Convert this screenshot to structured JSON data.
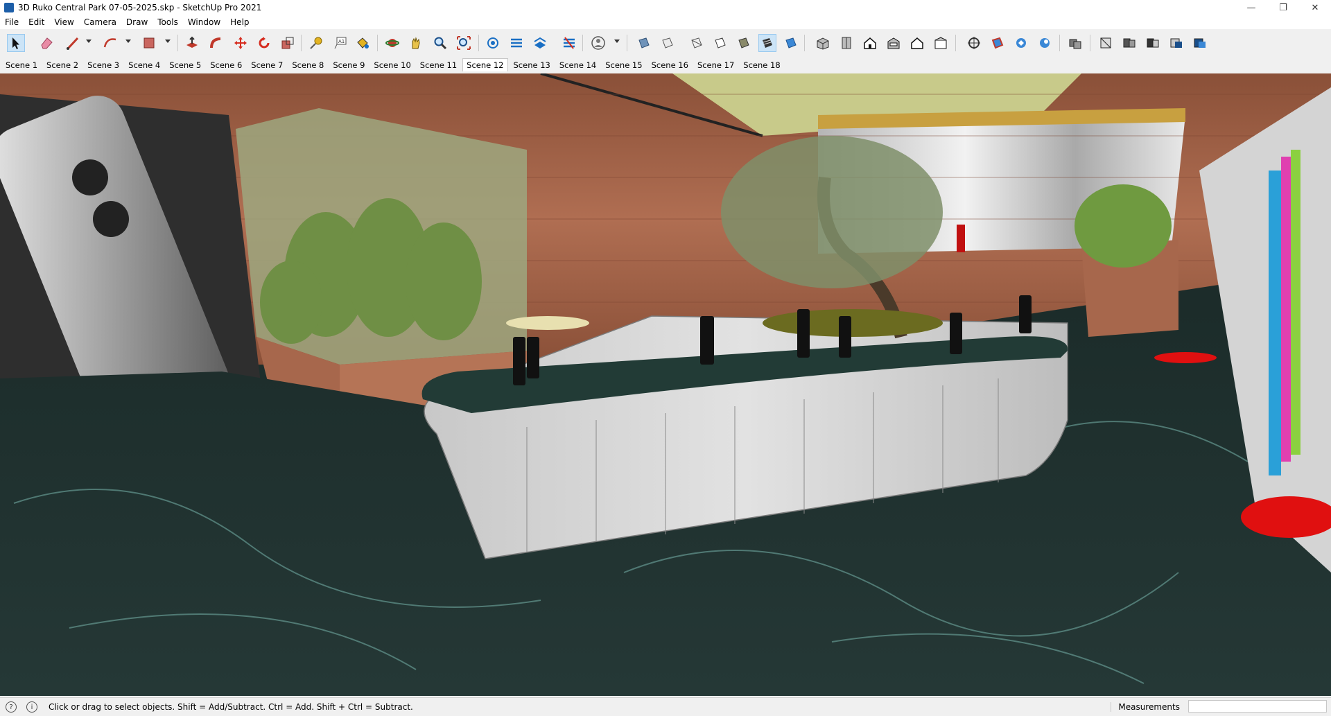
{
  "window": {
    "title": "3D Ruko Central Park 07-05-2025.skp - SketchUp Pro 2021",
    "controls": [
      "minimize-icon",
      "restore-icon",
      "close-icon"
    ]
  },
  "menu": [
    "File",
    "Edit",
    "View",
    "Camera",
    "Draw",
    "Tools",
    "Window",
    "Help"
  ],
  "toolbar": {
    "active_tool": "select",
    "tools": [
      "select",
      "eraser",
      "line",
      "arc",
      "rectangle",
      "push-pull",
      "follow-me",
      "move",
      "rotate",
      "scale",
      "tape-measure",
      "text",
      "paint-bucket",
      "orbit",
      "pan",
      "zoom",
      "zoom-extents",
      "section-plane",
      "section-display",
      "section-cut",
      "section-fill",
      "styles",
      "xray",
      "back-edges",
      "wireframe",
      "hidden-line",
      "shaded",
      "shaded-textures",
      "monochrome",
      "iso-view",
      "top-view",
      "front-view",
      "right-view",
      "back-view",
      "left-view",
      "views-extra",
      "solid-outer-shell",
      "solid-intersect",
      "solid-union",
      "solid-subtract",
      "solid-trim",
      "solid-split",
      "components",
      "warehouse"
    ]
  },
  "scenes": {
    "active": "Scene 12",
    "tabs": [
      "Scene 1",
      "Scene 2",
      "Scene 3",
      "Scene 4",
      "Scene 5",
      "Scene 6",
      "Scene 7",
      "Scene 8",
      "Scene 9",
      "Scene 10",
      "Scene 11",
      "Scene 12",
      "Scene 13",
      "Scene 14",
      "Scene 15",
      "Scene 16",
      "Scene 17",
      "Scene 18"
    ]
  },
  "status": {
    "hint": "Click or drag to select objects. Shift = Add/Subtract. Ctrl = Add. Shift + Ctrl = Subtract.",
    "measurements_label": "Measurements",
    "measurements_value": ""
  },
  "colors": {
    "floor": "#1e2e2c",
    "wood_wall": "#a7674c",
    "counter": "#d9d9d9",
    "ceiling": "#c8ca8a",
    "accent_red": "#e01010"
  }
}
